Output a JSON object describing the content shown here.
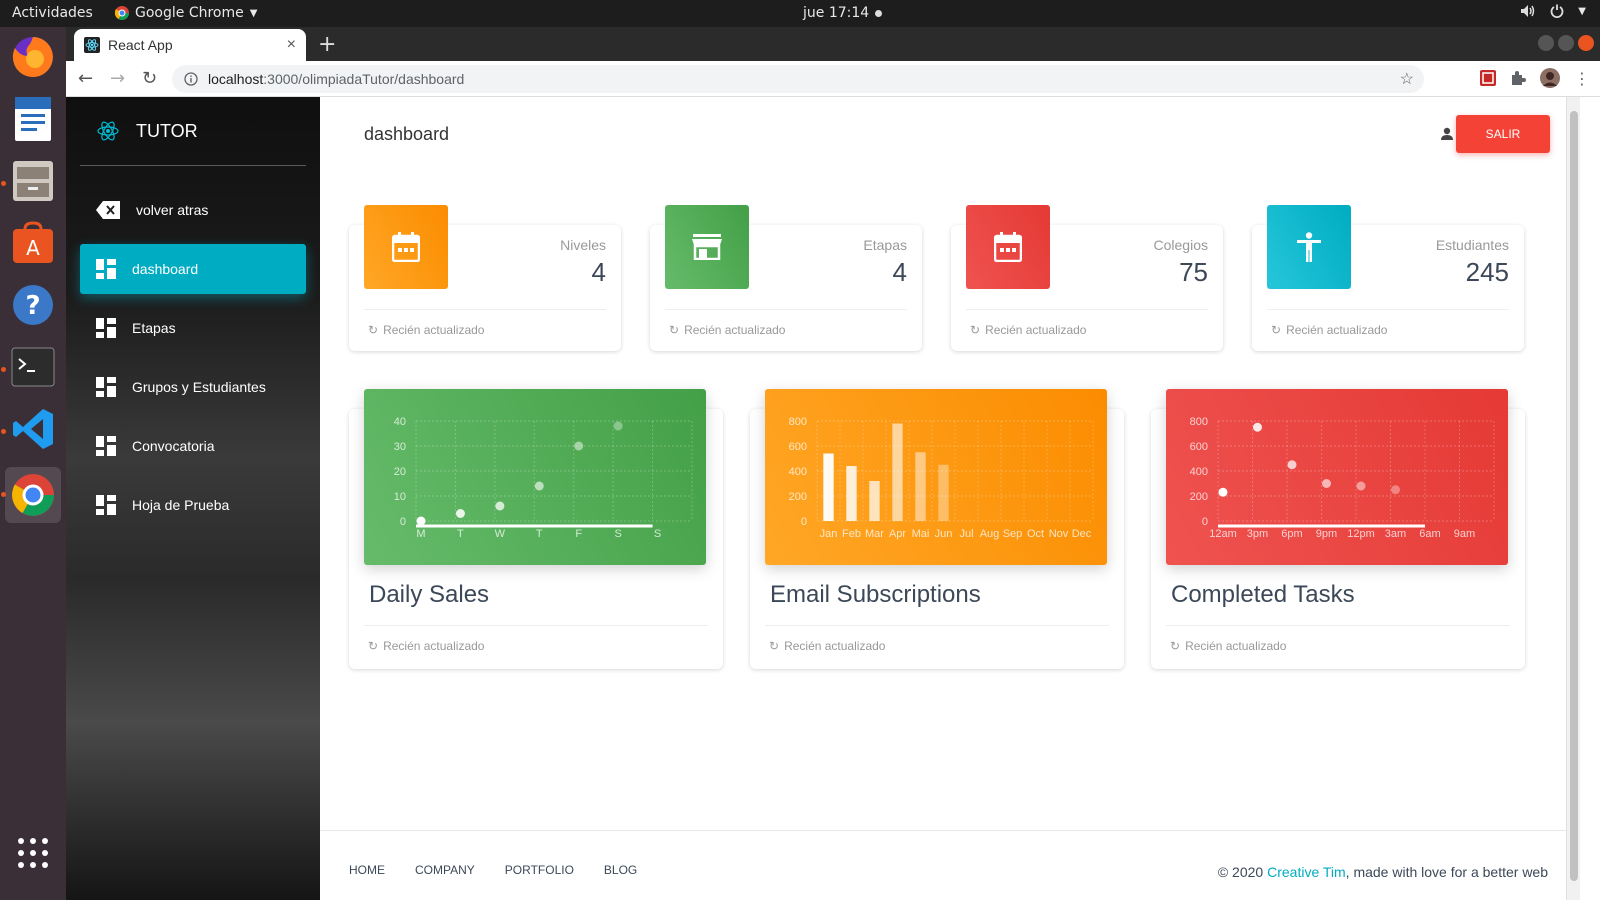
{
  "system": {
    "activities": "Actividades",
    "app_name": "Google Chrome",
    "clock": "jue 17:14"
  },
  "browser": {
    "tab_title": "React App",
    "url_host": "localhost",
    "url_path": ":3000/olimpiadaTutor/dashboard"
  },
  "sidebar": {
    "brand": "TUTOR",
    "items": [
      {
        "label": "volver atras",
        "icon": "backspace-icon"
      },
      {
        "label": "dashboard",
        "icon": "dashboard-icon",
        "active": true
      },
      {
        "label": "Etapas",
        "icon": "dashboard-icon"
      },
      {
        "label": "Grupos y Estudiantes",
        "icon": "dashboard-icon"
      },
      {
        "label": "Convocatoria",
        "icon": "dashboard-icon"
      },
      {
        "label": "Hoja de Prueba",
        "icon": "dashboard-icon"
      }
    ]
  },
  "header": {
    "title": "dashboard",
    "logout_label": "SALIR"
  },
  "stats": [
    {
      "label": "Niveles",
      "value": "4",
      "footer": "Recién actualizado",
      "color": "#ff9800",
      "icon": "calendar-icon"
    },
    {
      "label": "Etapas",
      "value": "4",
      "footer": "Recién actualizado",
      "color": "#43a047",
      "icon": "store-icon"
    },
    {
      "label": "Colegios",
      "value": "75",
      "footer": "Recién actualizado",
      "color": "#e53935",
      "icon": "calendar-icon"
    },
    {
      "label": "Estudiantes",
      "value": "245",
      "footer": "Recién actualizado",
      "color": "#00acc1",
      "icon": "accessibility-icon"
    }
  ],
  "charts": [
    {
      "title": "Daily Sales",
      "footer": "Recién actualizado",
      "color": "#43a047"
    },
    {
      "title": "Email Subscriptions",
      "footer": "Recién actualizado",
      "color": "#fb8c00"
    },
    {
      "title": "Completed Tasks",
      "footer": "Recién actualizado",
      "color": "#e53935"
    }
  ],
  "chart_data": [
    {
      "type": "scatter",
      "title": "Daily Sales",
      "categories": [
        "M",
        "T",
        "W",
        "T",
        "F",
        "S",
        "S"
      ],
      "values": [
        0,
        3,
        6,
        14,
        30,
        38,
        null
      ],
      "ylim": [
        0,
        40
      ],
      "yticks": [
        0,
        10,
        20,
        30,
        40
      ],
      "grid": true
    },
    {
      "type": "bar",
      "title": "Email Subscriptions",
      "categories": [
        "Jan",
        "Feb",
        "Mar",
        "Apr",
        "Mai",
        "Jun",
        "Jul",
        "Aug",
        "Sep",
        "Oct",
        "Nov",
        "Dec"
      ],
      "values": [
        540,
        440,
        320,
        780,
        550,
        450,
        null,
        null,
        null,
        null,
        null,
        null
      ],
      "ylim": [
        0,
        800
      ],
      "yticks": [
        0,
        200,
        400,
        600,
        800
      ],
      "grid": true
    },
    {
      "type": "scatter",
      "title": "Completed Tasks",
      "categories": [
        "12am",
        "3pm",
        "6pm",
        "9pm",
        "12pm",
        "3am",
        "6am",
        "9am"
      ],
      "values": [
        230,
        750,
        450,
        300,
        280,
        250,
        null,
        null
      ],
      "ylim": [
        0,
        800
      ],
      "yticks": [
        0,
        200,
        400,
        600,
        800
      ],
      "grid": true
    }
  ],
  "footer": {
    "links": [
      "HOME",
      "COMPANY",
      "PORTFOLIO",
      "BLOG"
    ],
    "copyright_prefix": "© 2020 ",
    "copyright_link": "Creative Tim",
    "copyright_suffix": ", made with love for a better web"
  }
}
